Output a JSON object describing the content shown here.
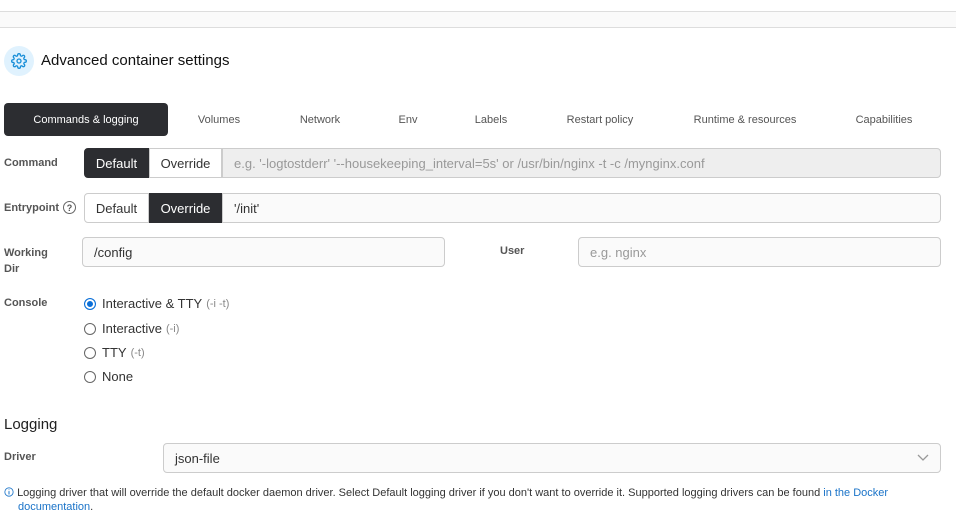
{
  "header": {
    "title": "Advanced container settings",
    "icon": "gear-icon"
  },
  "tabs": [
    {
      "label": "Commands & logging",
      "active": true
    },
    {
      "label": "Volumes"
    },
    {
      "label": "Network"
    },
    {
      "label": "Env"
    },
    {
      "label": "Labels"
    },
    {
      "label": "Restart policy"
    },
    {
      "label": "Runtime & resources"
    },
    {
      "label": "Capabilities"
    }
  ],
  "command": {
    "label": "Command",
    "default_label": "Default",
    "override_label": "Override",
    "selected": "Default",
    "placeholder": "e.g. '-logtostderr' '--housekeeping_interval=5s' or /usr/bin/nginx -t -c /mynginx.conf"
  },
  "entrypoint": {
    "label": "Entrypoint",
    "default_label": "Default",
    "override_label": "Override",
    "selected": "Override",
    "value": "'/init'"
  },
  "working_dir": {
    "label_line1": "Working",
    "label_line2": "Dir",
    "value": "/config"
  },
  "user": {
    "label": "User",
    "placeholder": "e.g. nginx"
  },
  "console": {
    "label": "Console",
    "options": [
      {
        "label": "Interactive & TTY",
        "flag": "(-i -t)",
        "selected": true
      },
      {
        "label": "Interactive",
        "flag": "(-i)"
      },
      {
        "label": "TTY",
        "flag": "(-t)"
      },
      {
        "label": "None",
        "flag": ""
      }
    ]
  },
  "logging": {
    "heading": "Logging",
    "driver_label": "Driver",
    "driver_value": "json-file",
    "info_text": "Logging driver that will override the default docker daemon driver. Select Default logging driver if you don't want to override it. Supported logging drivers can be found ",
    "info_link_prefix": "in the Docker",
    "info_link_suffix": "documentation",
    "info_end": "."
  },
  "colors": {
    "accent": "#2c2d31",
    "link": "#1a73c8",
    "icon_bg": "#e0f2fe"
  }
}
